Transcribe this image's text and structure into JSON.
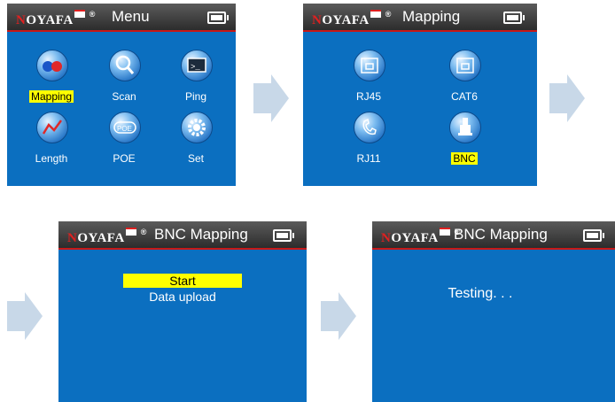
{
  "screens": [
    {
      "logo": "OYAFA",
      "logo_mark": "N",
      "registered": "®",
      "title": "Menu",
      "icons": [
        {
          "label": "Mapping",
          "icon": "mapping-icon",
          "selected": true
        },
        {
          "label": "Scan",
          "icon": "scan-icon",
          "selected": false
        },
        {
          "label": "Ping",
          "icon": "ping-icon",
          "selected": false
        },
        {
          "label": "Length",
          "icon": "length-icon",
          "selected": false
        },
        {
          "label": "POE",
          "icon": "poe-icon",
          "selected": false
        },
        {
          "label": "Set",
          "icon": "set-icon",
          "selected": false
        }
      ]
    },
    {
      "logo": "OYAFA",
      "logo_mark": "N",
      "registered": "®",
      "title": "Mapping",
      "icons": [
        {
          "label": "RJ45",
          "icon": "rj45-icon",
          "selected": false
        },
        {
          "label": "CAT6",
          "icon": "cat6-icon",
          "selected": false
        },
        {
          "label": "RJ11",
          "icon": "rj11-icon",
          "selected": false
        },
        {
          "label": "BNC",
          "icon": "bnc-icon",
          "selected": true
        }
      ]
    },
    {
      "logo": "OYAFA",
      "logo_mark": "N",
      "registered": "®",
      "title": "BNC Mapping",
      "menu": [
        {
          "label": "Start",
          "selected": true
        },
        {
          "label": "Data upload",
          "selected": false
        }
      ]
    },
    {
      "logo": "OYAFA",
      "logo_mark": "N",
      "registered": "®",
      "title": "BNC Mapping",
      "status": "Testing. . ."
    }
  ],
  "colors": {
    "screen_bg": "#0b6fc0",
    "title_bar": "#3a3a3a",
    "accent_red": "#c81818",
    "highlight": "#ffff00",
    "arrow": "#c8d8e8"
  }
}
